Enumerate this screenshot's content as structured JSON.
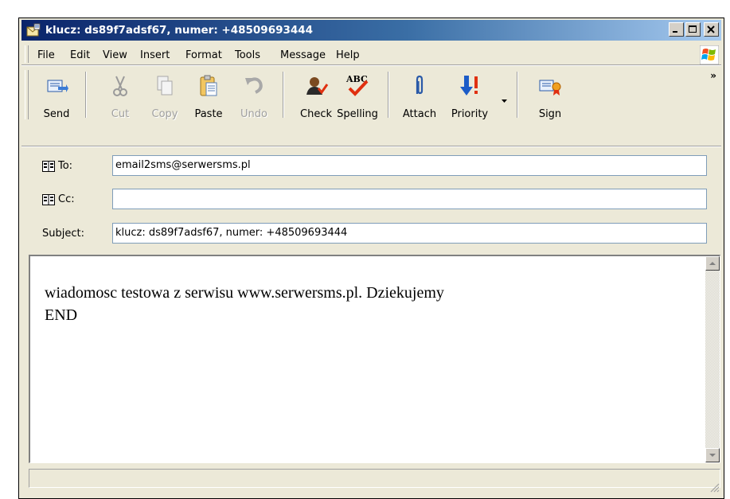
{
  "window": {
    "title": "klucz: ds89f7adsf67, numer: +48509693444"
  },
  "menu": [
    {
      "label": "File"
    },
    {
      "label": "Edit"
    },
    {
      "label": "View"
    },
    {
      "label": "Insert"
    },
    {
      "label": "Format"
    },
    {
      "label": "Tools"
    },
    {
      "label": "Message"
    },
    {
      "label": "Help"
    }
  ],
  "toolbar": {
    "send": "Send",
    "cut": "Cut",
    "copy": "Copy",
    "paste": "Paste",
    "undo": "Undo",
    "check": "Check",
    "spelling": "Spelling",
    "attach": "Attach",
    "priority": "Priority",
    "sign": "Sign",
    "more": "»"
  },
  "header": {
    "to_label": "To:",
    "to_value": "email2sms@serwersms.pl",
    "cc_label": "Cc:",
    "cc_value": "",
    "subject_label": "Subject:",
    "subject_value": "klucz: ds89f7adsf67, numer: +48509693444"
  },
  "body": {
    "line1": "wiadomosc testowa z serwisu www.serwersms.pl. Dziekujemy",
    "line2": "END"
  },
  "colors": {
    "titlebar_start": "#0a246a",
    "titlebar_end": "#a6caf0",
    "chrome": "#ece9d8"
  }
}
